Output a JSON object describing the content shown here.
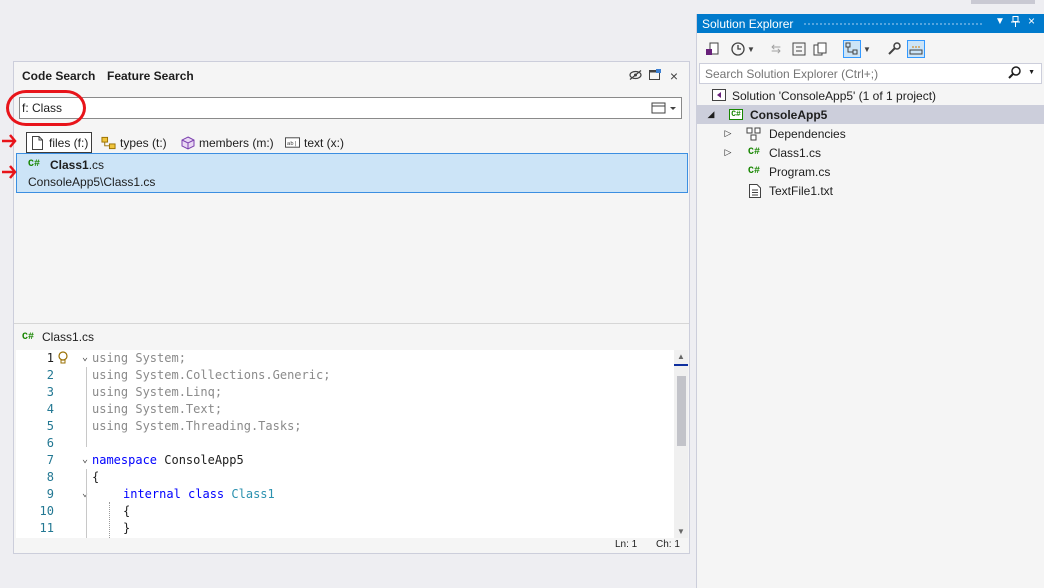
{
  "code_search": {
    "tabs": [
      "Code Search",
      "Feature Search"
    ],
    "search_value": "f: Class",
    "filters": [
      {
        "label": "files (f:)",
        "icon": "file-icon",
        "active": true
      },
      {
        "label": "types (t:)",
        "icon": "types-icon",
        "active": false
      },
      {
        "label": "members (m:)",
        "icon": "cube-icon",
        "active": false
      },
      {
        "label": "text (x:)",
        "icon": "text-field-icon",
        "active": false
      }
    ],
    "result": {
      "glyph": "C#",
      "name_bold": "Class1",
      "name_rest": ".cs",
      "path": "ConsoleApp5\\Class1.cs"
    },
    "preview": {
      "glyph": "C#",
      "file": "Class1.cs",
      "line_numbers": [
        "1",
        "2",
        "3",
        "4",
        "5",
        "6",
        "7",
        "8",
        "9",
        "10",
        "11"
      ],
      "lines": [
        [
          "using",
          " System;"
        ],
        [
          "using",
          " System.Collections.Generic;"
        ],
        [
          "using",
          " System.Linq;"
        ],
        [
          "using",
          " System.Text;"
        ],
        [
          "using",
          " System.Threading.Tasks;"
        ],
        [
          "",
          ""
        ],
        [
          "namespace",
          " ConsoleApp5"
        ],
        [
          "",
          "{"
        ],
        [
          "internal class",
          "Class1"
        ],
        [
          "",
          "{"
        ],
        [
          "",
          "}"
        ]
      ],
      "status_ln": "Ln: 1",
      "status_ch": "Ch: 1"
    }
  },
  "solution_explorer": {
    "title": "Solution Explorer",
    "search_placeholder": "Search Solution Explorer (Ctrl+;)",
    "solution": "Solution 'ConsoleApp5' (1 of 1 project)",
    "project": "ConsoleApp5",
    "items": [
      {
        "label": "Dependencies",
        "icon": "dependencies-icon",
        "expandable": true
      },
      {
        "label": "Class1.cs",
        "icon": "csharp-file-icon",
        "expandable": true
      },
      {
        "label": "Program.cs",
        "icon": "csharp-file-icon",
        "expandable": false
      },
      {
        "label": "TextFile1.txt",
        "icon": "text-file-icon",
        "expandable": false
      }
    ]
  },
  "colors": {
    "accent": "#007acc",
    "selection": "#cce4f7",
    "annotation": "#e8141a",
    "csharp": "#178600"
  }
}
